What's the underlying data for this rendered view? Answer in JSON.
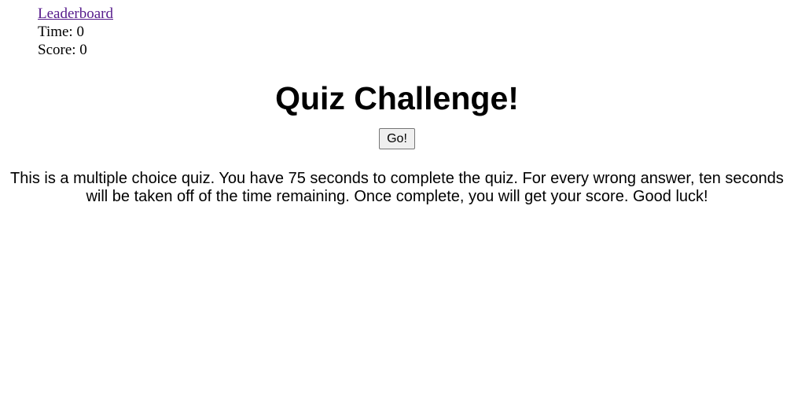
{
  "header": {
    "leaderboard_link": "Leaderboard",
    "time_label": "Time: ",
    "time_value": "0",
    "score_label": "Score: ",
    "score_value": "0"
  },
  "main": {
    "title": "Quiz Challenge!",
    "go_button": "Go!",
    "description": "This is a multiple choice quiz. You have 75 seconds to complete the quiz. For every wrong answer, ten seconds will be taken off of the time remaining. Once complete, you will get your score. Good luck!"
  },
  "colors": {
    "link": "#551a8b",
    "text": "#000000",
    "background": "#ffffff"
  }
}
